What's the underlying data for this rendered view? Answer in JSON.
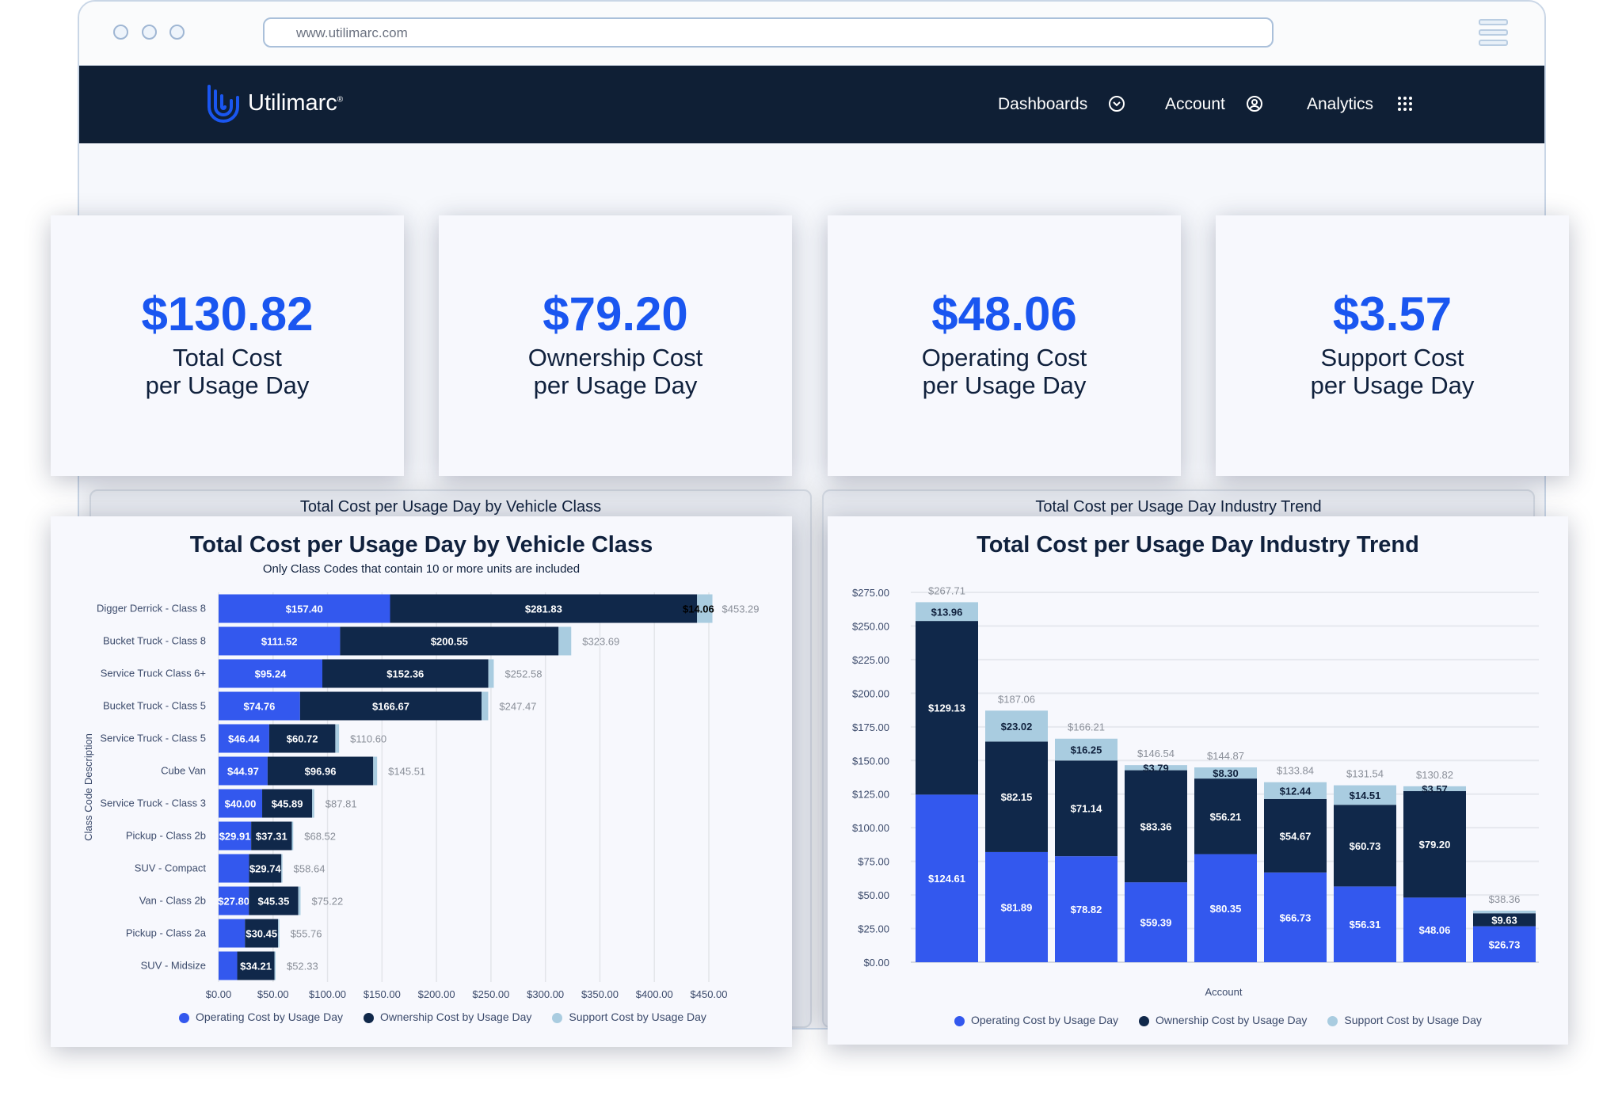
{
  "browser": {
    "url": "www.utilimarc.com"
  },
  "nav": {
    "brand": "Utilimarc",
    "brand_mark": "®",
    "items": [
      {
        "label": "Dashboards",
        "icon": "chevron-circle-icon"
      },
      {
        "label": "Account",
        "icon": "user-circle-icon"
      },
      {
        "label": "Analytics",
        "icon": "grid-icon"
      }
    ]
  },
  "kpis": [
    {
      "value": "$130.82",
      "line1": "Total Cost",
      "line2": "per Usage Day"
    },
    {
      "value": "$79.20",
      "line1": "Ownership Cost",
      "line2": "per Usage Day"
    },
    {
      "value": "$48.06",
      "line1": "Operating Cost",
      "line2": "per Usage Day"
    },
    {
      "value": "$3.57",
      "line1": "Support Cost",
      "line2": "per Usage Day"
    }
  ],
  "colors": {
    "accent": "#1a56f0",
    "operating": "#3358ee",
    "ownership": "#10284a",
    "support": "#a9cce0",
    "nav_bg": "#0f1f35"
  },
  "chart_data": [
    {
      "type": "bar",
      "orientation": "horizontal",
      "stacked": true,
      "title": "Total Cost per Usage Day by Vehicle Class",
      "ghost_title": "Total Cost per Usage Day by Vehicle Class",
      "subtitle": "Only Class Codes that contain 10 or more units are included",
      "ylabel": "Class Code Description",
      "xlabel": "",
      "xlim": [
        0,
        450
      ],
      "x_ticks": [
        "$0.00",
        "$50.00",
        "$100.00",
        "$150.00",
        "$200.00",
        "$250.00",
        "$300.00",
        "$350.00",
        "$400.00",
        "$450.00"
      ],
      "grid": true,
      "legend_position": "bottom",
      "categories": [
        "Digger Derrick - Class 8",
        "Bucket Truck - Class 8",
        "Service Truck Class 6+",
        "Bucket Truck - Class 5",
        "Service Truck - Class 5",
        "Cube Van",
        "Service Truck - Class 3",
        "Pickup - Class 2b",
        "SUV - Compact",
        "Van - Class 2b",
        "Pickup - Class 2a",
        "SUV - Midsize"
      ],
      "series": [
        {
          "name": "Operating Cost by Usage Day",
          "values": [
            157.4,
            111.52,
            95.24,
            74.76,
            46.44,
            44.97,
            40.0,
            29.91,
            27.9,
            27.8,
            24.2,
            17.1
          ],
          "labels": [
            "$157.40",
            "$111.52",
            "$95.24",
            "$74.76",
            "$46.44",
            "$44.97",
            "$40.00",
            "$29.91",
            "",
            "$27.80",
            "",
            ""
          ]
        },
        {
          "name": "Ownership Cost by Usage Day",
          "values": [
            281.83,
            200.55,
            152.36,
            166.67,
            60.72,
            96.96,
            45.89,
            37.31,
            29.74,
            45.35,
            30.45,
            34.21
          ],
          "labels": [
            "$281.83",
            "$200.55",
            "$152.36",
            "$166.67",
            "$60.72",
            "$96.96",
            "$45.89",
            "$37.31",
            "$29.74",
            "$45.35",
            "$30.45",
            "$34.21"
          ]
        },
        {
          "name": "Support Cost by Usage Day",
          "values": [
            14.06,
            11.62,
            4.98,
            6.04,
            3.44,
            3.58,
            1.92,
            1.3,
            1.0,
            2.07,
            1.11,
            1.02
          ],
          "labels": [
            "$14.06",
            "",
            "",
            "",
            "",
            "",
            "",
            "",
            "",
            "",
            "",
            ""
          ]
        }
      ],
      "totals": [
        "$453.29",
        "$323.69",
        "$252.58",
        "$247.47",
        "$110.60",
        "$145.51",
        "$87.81",
        "$68.52",
        "$58.64",
        "$75.22",
        "$55.76",
        "$52.33"
      ]
    },
    {
      "type": "bar",
      "orientation": "vertical",
      "stacked": true,
      "title": "Total Cost per Usage Day Industry Trend",
      "ghost_title": "Total Cost per Usage Day Industry Trend",
      "xlabel": "Account",
      "ylabel": "",
      "ylim": [
        0,
        275
      ],
      "y_ticks": [
        "$0.00",
        "$25.00",
        "$50.00",
        "$75.00",
        "$100.00",
        "$125.00",
        "$150.00",
        "$175.00",
        "$200.00",
        "$225.00",
        "$250.00",
        "$275.00"
      ],
      "grid": true,
      "legend_position": "bottom",
      "categories": [
        "",
        "",
        "",
        "",
        "",
        "",
        "",
        "",
        ""
      ],
      "series": [
        {
          "name": "Operating Cost by Usage Day",
          "values": [
            124.61,
            81.89,
            78.82,
            59.39,
            80.35,
            66.73,
            56.31,
            48.06,
            26.73
          ],
          "labels": [
            "$124.61",
            "$81.89",
            "$78.82",
            "$59.39",
            "$80.35",
            "$66.73",
            "$56.31",
            "$48.06",
            "$26.73"
          ]
        },
        {
          "name": "Ownership Cost by Usage Day",
          "values": [
            129.13,
            82.15,
            71.14,
            83.36,
            56.21,
            54.67,
            60.73,
            79.2,
            9.63
          ],
          "labels": [
            "$129.13",
            "$82.15",
            "$71.14",
            "$83.36",
            "$56.21",
            "$54.67",
            "$60.73",
            "$79.20",
            "$9.63"
          ]
        },
        {
          "name": "Support Cost by Usage Day",
          "values": [
            13.96,
            23.02,
            16.25,
            3.79,
            8.3,
            12.44,
            14.51,
            3.57,
            2.0
          ],
          "labels": [
            "$13.96",
            "$23.02",
            "$16.25",
            "$3.79",
            "$8.30",
            "$12.44",
            "$14.51",
            "$3.57",
            ""
          ]
        }
      ],
      "totals": [
        "$267.71",
        "$187.06",
        "$166.21",
        "$146.54",
        "$144.87",
        "$133.84",
        "$131.54",
        "$130.82",
        "$38.36"
      ]
    }
  ]
}
